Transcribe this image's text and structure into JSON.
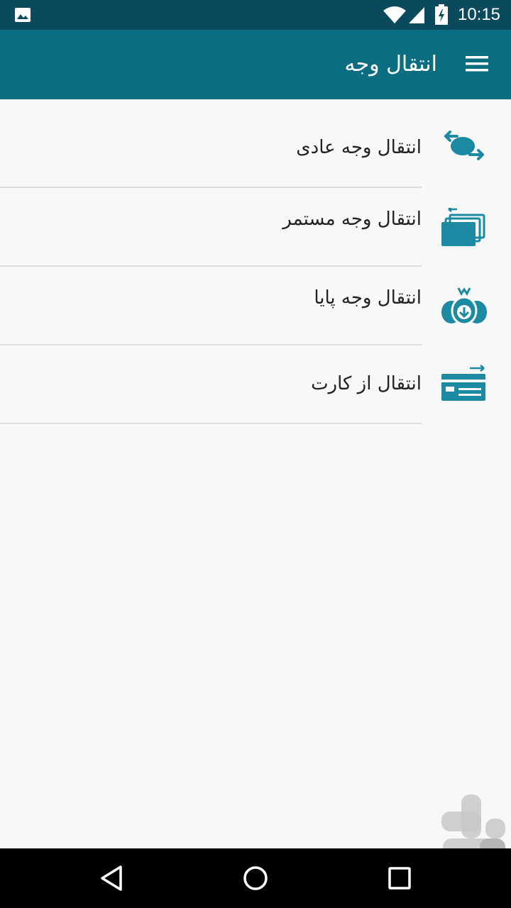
{
  "status_bar": {
    "time": "10:15",
    "icons": [
      "image-icon",
      "wifi-icon",
      "signal-icon",
      "battery-icon"
    ]
  },
  "app_bar": {
    "title": "انتقال وجه",
    "menu_icon": "menu-icon"
  },
  "menu": {
    "items": [
      {
        "label": "انتقال وجه عادی",
        "icon": "exchange-icon"
      },
      {
        "label": "انتقال وجه مستمر",
        "icon": "recurring-cards-icon"
      },
      {
        "label": "انتقال وجه پایا",
        "icon": "money-bags-icon"
      },
      {
        "label": "انتقال از کارت",
        "icon": "card-transfer-icon"
      }
    ]
  },
  "nav_bar": {
    "buttons": [
      "back-icon",
      "home-icon",
      "recents-icon"
    ]
  },
  "colors": {
    "status_bar": "#0b4a5c",
    "app_bar": "#0a6e80",
    "icon_accent": "#1c8aa3",
    "background": "#f8f8f8",
    "divider": "#dddddd"
  }
}
